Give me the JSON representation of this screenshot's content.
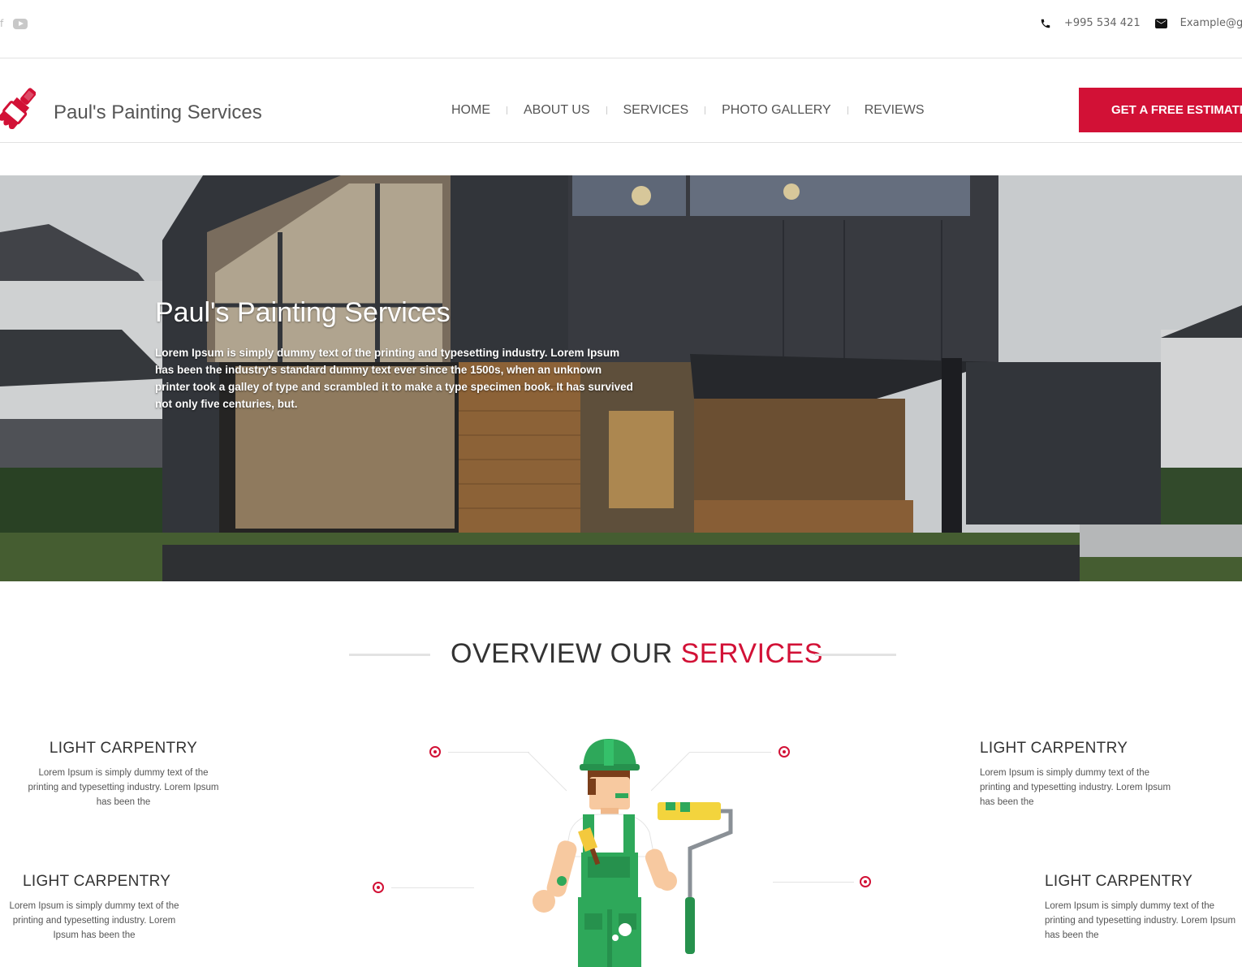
{
  "topbar": {
    "social": [
      "facebook-icon",
      "youtube-icon"
    ],
    "phone": "+995 534 421",
    "email": "Example@gma"
  },
  "header": {
    "brand": "Paul's Painting Services",
    "nav": [
      "HOME",
      "ABOUT US",
      "SERVICES",
      "PHOTO GALLERY",
      "REVIEWS"
    ],
    "cta": "GET A FREE ESTIMATE"
  },
  "hero": {
    "title": "Paul's Painting Services",
    "text": "Lorem Ipsum is simply dummy text of the printing and typesetting industry. Lorem Ipsum has been the industry's standard dummy text ever since the 1500s, when an unknown printer took a galley of type and scrambled it to make a type specimen book. It has survived not only five centuries, but."
  },
  "services": {
    "heading_main": "OVERVIEW OUR ",
    "heading_accent": "SERVICES",
    "items": [
      {
        "title": "LIGHT CARPENTRY",
        "text": "Lorem Ipsum is simply dummy text of the printing and typesetting industry. Lorem Ipsum has been the"
      },
      {
        "title": "LIGHT CARPENTRY",
        "text": "Lorem Ipsum is simply dummy text of the printing and typesetting industry. Lorem Ipsum has been the"
      },
      {
        "title": "LIGHT CARPENTRY",
        "text": "Lorem Ipsum is simply dummy text of the printing and typesetting industry. Lorem Ipsum has been the"
      },
      {
        "title": "LIGHT CARPENTRY",
        "text": "Lorem Ipsum is simply dummy text of the printing and typesetting industry. Lorem Ipsum has been the"
      }
    ]
  },
  "colors": {
    "accent": "#d21136",
    "text": "#333333",
    "muted": "#555555"
  }
}
